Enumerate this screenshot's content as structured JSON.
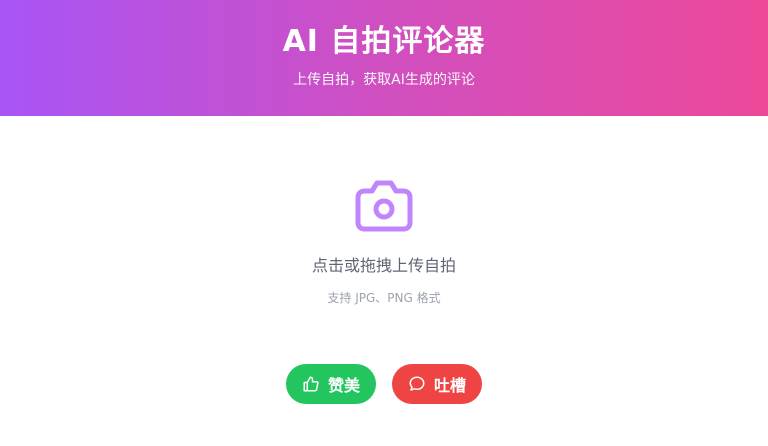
{
  "header": {
    "title": "AI 自拍评论器",
    "subtitle": "上传自拍，获取AI生成的评论",
    "gradient_start": "#a855f7",
    "gradient_end": "#ec4899"
  },
  "upload": {
    "icon": "camera-icon",
    "prompt": "点击或拖拽上传自拍",
    "hint": "支持 JPG、PNG 格式",
    "icon_color": "#c084fc"
  },
  "actions": {
    "praise": {
      "label": "赞美",
      "icon": "thumbs-up-icon",
      "color": "#22c55e"
    },
    "roast": {
      "label": "吐槽",
      "icon": "speech-bubble-icon",
      "color": "#ef4444"
    }
  }
}
